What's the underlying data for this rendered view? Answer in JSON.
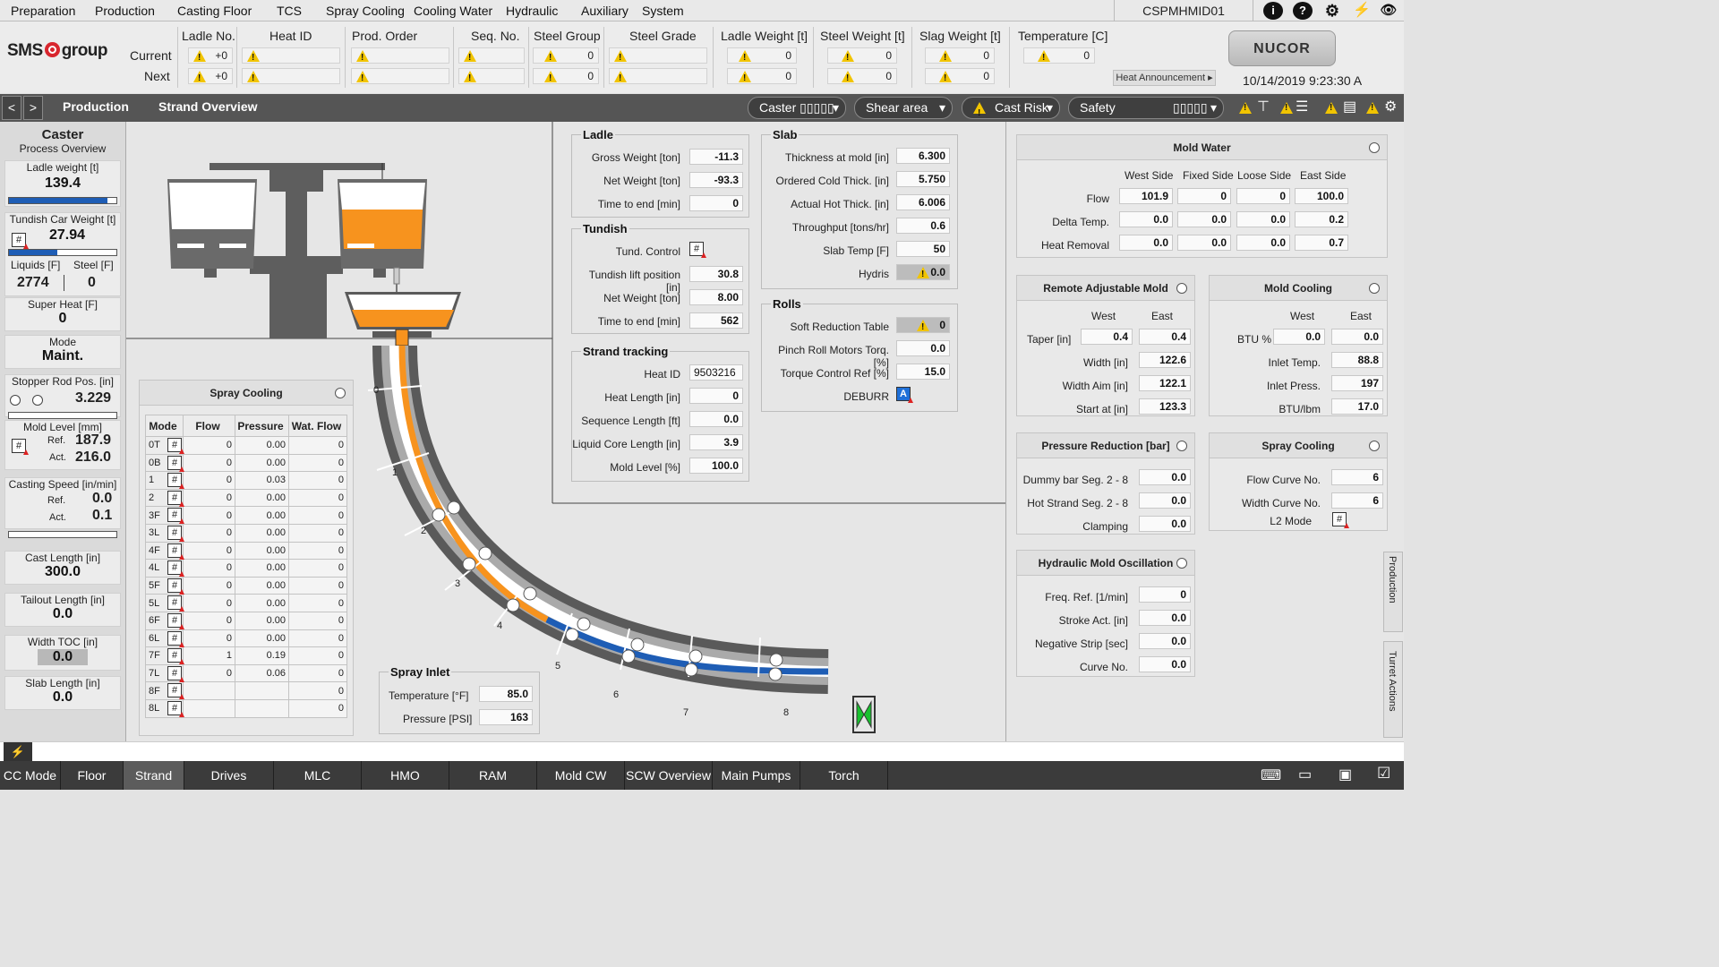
{
  "menu": [
    "Preparation",
    "Production",
    "Casting Floor",
    "TCS",
    "Spray Cooling",
    "Cooling Water",
    "Hydraulic",
    "Auxiliary",
    "System"
  ],
  "hmi_id": "CSPMHMID01",
  "toolbar_icons": [
    "info-icon",
    "help-icon",
    "settings-icon",
    "power-icon",
    "view-icon"
  ],
  "header": {
    "logo": "SMS group",
    "columns": [
      "Ladle No.",
      "Heat ID",
      "Prod. Order",
      "Seq. No.",
      "Steel Group",
      "Steel Grade",
      "Ladle Weight  [t]",
      "Steel Weight  [t]",
      "Slag Weight  [t]",
      "Temperature [C]"
    ],
    "rows": [
      {
        "label": "Current",
        "ladle": "+0",
        "steel_group": "0",
        "ladle_weight": "0",
        "steel_weight": "0",
        "slag_weight": "0",
        "temperature": "0"
      },
      {
        "label": "Next",
        "ladle": "+0",
        "steel_group": "0",
        "ladle_weight": "0",
        "steel_weight": "0",
        "slag_weight": "0"
      }
    ],
    "brand": "NUCOR",
    "heat_announcement": "Heat Announcement ▸",
    "datetime": "10/14/2019 9:23:30 A"
  },
  "nav": {
    "back": "<",
    "forward": ">",
    "crumb1": "Production",
    "crumb2": "Strand Overview",
    "caster": "Caster ▯▯▯▯▯",
    "shear": "Shear area ▯▯▯",
    "cast_risk": "Cast Risk",
    "safety": "Safety",
    "safety_box": "▯▯▯▯▯"
  },
  "left": {
    "title": "Caster",
    "subtitle": "Process Overview",
    "ladle_weight_label": "Ladle weight [t]",
    "ladle_weight": "139.4",
    "ladle_weight_level": 0.92,
    "tundish_label": "Tundish Car Weight [t]",
    "tundish": "27.94",
    "tundish_level": 0.45,
    "liquids_label": "Liquids [F]",
    "steel_label": "Steel [F]",
    "liquids": "2774",
    "steel": "0",
    "superheat_label": "Super Heat [F]",
    "superheat": "0",
    "mode_label": "Mode",
    "mode": "Maint.",
    "stopper_label": "Stopper Rod Pos. [in]",
    "stopper": "3.229",
    "mold_level_label": "Mold Level [mm]",
    "ref_label": "Ref.",
    "act_label": "Act.",
    "mold_ref": "187.9",
    "mold_act": "216.0",
    "casting_speed_label": "Casting Speed [in/min]",
    "cs_ref": "0.0",
    "cs_act": "0.1",
    "cast_length_label": "Cast Length [in]",
    "cast_length": "300.0",
    "tailout_label": "Tailout Length [in]",
    "tailout": "0.0",
    "width_toc_label": "Width TOC [in]",
    "width_toc": "0.0",
    "slab_length_label": "Slab Length [in]",
    "slab_length": "0.0"
  },
  "ladle_grp": {
    "title": "Ladle",
    "rows": [
      {
        "l": "Gross Weight [ton]",
        "v": "-11.3"
      },
      {
        "l": "Net Weight [ton]",
        "v": "-93.3"
      },
      {
        "l": "Time to end [min]",
        "v": "0"
      }
    ]
  },
  "tundish_grp": {
    "title": "Tundish",
    "control": "Tund. Control",
    "rows": [
      {
        "l": "Tundish lift position [in]",
        "v": "30.8"
      },
      {
        "l": "Net Weight [ton]",
        "v": "8.00"
      },
      {
        "l": "Time to end [min]",
        "v": "562"
      }
    ]
  },
  "tracking_grp": {
    "title": "Strand tracking",
    "rows": [
      {
        "l": "Heat ID",
        "v": "9503216"
      },
      {
        "l": "Heat Length [in]",
        "v": "0"
      },
      {
        "l": "Sequence Length [ft]",
        "v": "0.0"
      },
      {
        "l": "Liquid Core Length [in]",
        "v": "3.9"
      },
      {
        "l": "Mold Level [%]",
        "v": "100.0"
      }
    ]
  },
  "slab_grp": {
    "title": "Slab",
    "rows": [
      {
        "l": "Thickness at mold [in]",
        "v": "6.300"
      },
      {
        "l": "Ordered Cold Thick. [in]",
        "v": "5.750"
      },
      {
        "l": "Actual Hot Thick. [in]",
        "v": "6.006"
      },
      {
        "l": "Throughput [tons/hr]",
        "v": "0.6"
      },
      {
        "l": "Slab Temp [F]",
        "v": "50"
      },
      {
        "l": "Hydris",
        "v": "0.0"
      }
    ]
  },
  "rolls_grp": {
    "title": "Rolls",
    "rows": [
      {
        "l": "Soft Reduction Table",
        "v": "0"
      },
      {
        "l": "Pinch Roll Motors Torq. [%]",
        "v": "0.0"
      },
      {
        "l": "Torque Control Ref [%]",
        "v": "15.0"
      }
    ],
    "deburr": "DEBURR",
    "deburr_btn": "A"
  },
  "spray": {
    "title": "Spray Cooling",
    "headers": [
      "Mode",
      "Flow",
      "Pressure",
      "Wat. Flow"
    ],
    "rows": [
      {
        "m": "0T",
        "f": "0",
        "p": "0.00",
        "w": "0"
      },
      {
        "m": "0B",
        "f": "0",
        "p": "0.00",
        "w": "0"
      },
      {
        "m": "1",
        "f": "0",
        "p": "0.03",
        "w": "0"
      },
      {
        "m": "2",
        "f": "0",
        "p": "0.00",
        "w": "0"
      },
      {
        "m": "3F",
        "f": "0",
        "p": "0.00",
        "w": "0"
      },
      {
        "m": "3L",
        "f": "0",
        "p": "0.00",
        "w": "0"
      },
      {
        "m": "4F",
        "f": "0",
        "p": "0.00",
        "w": "0"
      },
      {
        "m": "4L",
        "f": "0",
        "p": "0.00",
        "w": "0"
      },
      {
        "m": "5F",
        "f": "0",
        "p": "0.00",
        "w": "0"
      },
      {
        "m": "5L",
        "f": "0",
        "p": "0.00",
        "w": "0"
      },
      {
        "m": "6F",
        "f": "0",
        "p": "0.00",
        "w": "0"
      },
      {
        "m": "6L",
        "f": "0",
        "p": "0.00",
        "w": "0"
      },
      {
        "m": "7F",
        "f": "1",
        "p": "0.19",
        "w": "0"
      },
      {
        "m": "7L",
        "f": "0",
        "p": "0.06",
        "w": "0"
      },
      {
        "m": "8F",
        "f": "",
        "p": "",
        "w": "0"
      },
      {
        "m": "8L",
        "f": "",
        "p": "",
        "w": "0"
      }
    ]
  },
  "spray_inlet": {
    "title": "Spray Inlet",
    "temp_label": "Temperature  [°F]",
    "temp": "85.0",
    "press_label": "Pressure  [PSI]",
    "press": "163"
  },
  "segments": [
    "0",
    "1",
    "2",
    "3",
    "4",
    "5",
    "6",
    "7",
    "8"
  ],
  "mold_water": {
    "title": "Mold Water",
    "cols": [
      "West Side",
      "Fixed Side",
      "Loose Side",
      "East Side"
    ],
    "rows": [
      {
        "l": "Flow",
        "v": [
          "101.9",
          "0",
          "0",
          "100.0"
        ]
      },
      {
        "l": "Delta Temp.",
        "v": [
          "0.0",
          "0.0",
          "0.0",
          "0.2"
        ]
      },
      {
        "l": "Heat Removal",
        "v": [
          "0.0",
          "0.0",
          "0.0",
          "0.7"
        ]
      }
    ]
  },
  "ram": {
    "title": "Remote Adjustable Mold",
    "west": "West",
    "east": "East",
    "taper_label": "Taper [in]",
    "taper_w": "0.4",
    "taper_e": "0.4",
    "rows": [
      {
        "l": "Width [in]",
        "v": "122.6"
      },
      {
        "l": "Width Aim [in]",
        "v": "122.1"
      },
      {
        "l": "Start at [in]",
        "v": "123.3"
      }
    ]
  },
  "mold_cooling": {
    "title": "Mold Cooling",
    "west": "West",
    "east": "East",
    "btu_label": "BTU %",
    "btu_w": "0.0",
    "btu_e": "0.0",
    "rows": [
      {
        "l": "Inlet Temp.",
        "v": "88.8"
      },
      {
        "l": "Inlet Press.",
        "v": "197"
      },
      {
        "l": "BTU/lbm",
        "v": "17.0"
      }
    ]
  },
  "pressure_red": {
    "title": "Pressure Reduction [bar]",
    "rows": [
      {
        "l": "Dummy bar Seg. 2 - 8",
        "v": "0.0"
      },
      {
        "l": "Hot Strand Seg. 2 - 8",
        "v": "0.0"
      },
      {
        "l": "Clamping",
        "v": "0.0"
      }
    ]
  },
  "spray_right": {
    "title": "Spray Cooling",
    "rows": [
      {
        "l": "Flow Curve No.",
        "v": "6"
      },
      {
        "l": "Width Curve No.",
        "v": "6"
      }
    ],
    "l2": "L2 Mode"
  },
  "hmo": {
    "title": "Hydraulic Mold Oscillation",
    "rows": [
      {
        "l": "Freq. Ref. [1/min]",
        "v": "0"
      },
      {
        "l": "Stroke Act. [in]",
        "v": "0.0"
      },
      {
        "l": "Negative Strip [sec]",
        "v": "0.0"
      },
      {
        "l": "Curve No.",
        "v": "0.0"
      }
    ]
  },
  "side_tabs": [
    "Production",
    "Turret Actions"
  ],
  "bottom_tabs": [
    "CC Mode",
    "Floor",
    "Strand",
    "Drives",
    "MLC",
    "HMO",
    "RAM",
    "Mold CW",
    "SCW Overview",
    "Main Pumps",
    "Torch"
  ],
  "colors": {
    "steel": "#f7931e",
    "water": "#1e5db5",
    "frame": "#5a5a5a",
    "nav": "#555555"
  }
}
